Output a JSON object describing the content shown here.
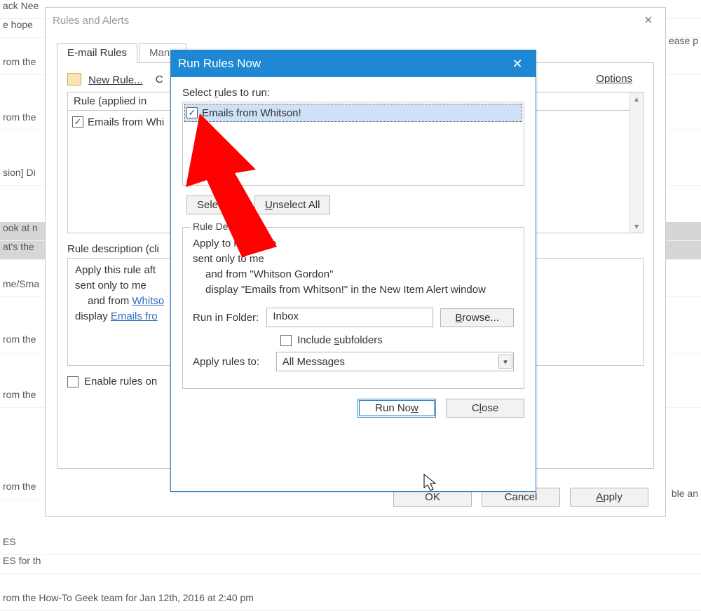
{
  "background": {
    "row1": "ack Nee",
    "row2": "e hope",
    "row3": "rom the",
    "row4": "rom the",
    "row5": "sion] Di",
    "row6": "ook at n",
    "row7": "at's the",
    "row8": "me/Sma",
    "row9": "rom the",
    "row10": "rom the",
    "row11": "rom the",
    "row12": "ES",
    "row13": "ES for th",
    "row14": "rom the How-To Geek team for Jan 12th, 2016 at 2:40 pm",
    "right1": "ease p",
    "right2": "ble an"
  },
  "rulesAlerts": {
    "title": "Rules and Alerts",
    "closeGlyph": "✕",
    "tabs": {
      "email": "E-mail Rules",
      "manage": "Mana"
    },
    "toolbar": {
      "newRule": "New Rule...",
      "changeRule": "C",
      "options": "Options"
    },
    "list": {
      "header": "Rule (applied in ",
      "row1": "Emails from Whi"
    },
    "descLabel": "Rule description (cli",
    "desc": {
      "l1": "Apply this rule aft",
      "l2": "sent only to me",
      "l3a": "and from ",
      "l3link": "Whitso",
      "l4a": "display ",
      "l4link": "Emails fro"
    },
    "enable": "Enable rules on ",
    "buttons": {
      "ok": "OK",
      "cancel": "Cancel",
      "apply": "Apply"
    }
  },
  "runRulesNow": {
    "title": "Run Rules Now",
    "closeGlyph": "✕",
    "selectLabel": "Select rules to run:",
    "listRow": "Emails from Whitson!",
    "buttons": {
      "selectAll": "Select ",
      "unselectAll": "Unselect All"
    },
    "group": {
      "title": "Rule Descrip",
      "desc": {
        "l1": "Apply to message",
        "l2": "sent only to me",
        "l3": "and from \"Whitson Gordon\"",
        "l4": "display \"Emails from Whitson!\" in the New Item Alert window"
      },
      "runInFolder": {
        "label": "Run in Folder:",
        "value": "Inbox",
        "browse": "Browse..."
      },
      "includeSub": "Include subfolders",
      "applyRulesTo": {
        "label": "Apply rules to:",
        "value": "All Messages"
      }
    },
    "bottom": {
      "runNow": "Run Now",
      "close": "Close"
    }
  },
  "underline_letters": {
    "new": "N",
    "options": "O",
    "rules": "r",
    "select_a": "A",
    "unselect": "U",
    "browse": "B",
    "subfolders": "s",
    "runnow": "w",
    "close": "l",
    "apply": "A"
  }
}
